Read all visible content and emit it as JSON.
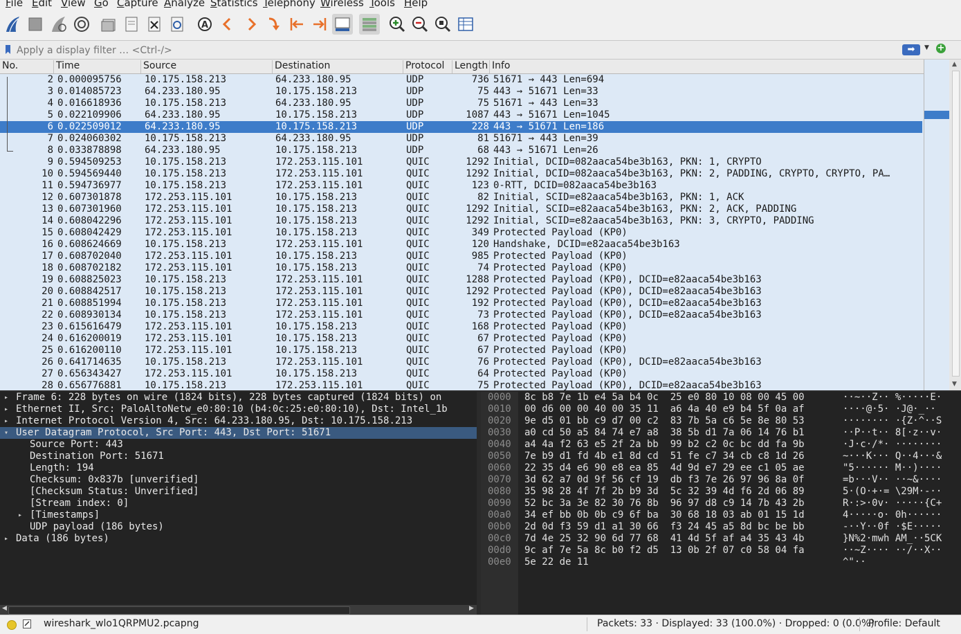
{
  "menubar": {
    "items": [
      "File",
      "Edit",
      "View",
      "Go",
      "Capture",
      "Analyze",
      "Statistics",
      "Telephony",
      "Wireless",
      "Tools",
      "Help"
    ]
  },
  "toolbar": {
    "icons": [
      "shark-fin-start-icon",
      "stop-capture-icon",
      "restart-capture-icon",
      "capture-options-icon",
      "open-file-icon",
      "save-file-icon",
      "close-file-icon",
      "reload-file-icon",
      "find-packet-icon",
      "go-back-icon",
      "go-forward-icon",
      "go-to-packet-icon",
      "first-packet-icon",
      "last-packet-icon",
      "autoscroll-icon",
      "colorize-icon",
      "zoom-in-icon",
      "zoom-out-icon",
      "zoom-normal-icon",
      "resize-columns-icon"
    ]
  },
  "filter": {
    "placeholder": "Apply a display filter … <Ctrl-/>",
    "apply_label": "➡"
  },
  "packet_list": {
    "columns": [
      "No.",
      "Time",
      "Source",
      "Destination",
      "Protocol",
      "Length",
      "Info"
    ],
    "rows": [
      {
        "no": "2",
        "time": "0.000095756",
        "src": "10.175.158.213",
        "dst": "64.233.180.95",
        "proto": "UDP",
        "len": "736",
        "info": "51671 → 443 Len=694"
      },
      {
        "no": "3",
        "time": "0.014085723",
        "src": "64.233.180.95",
        "dst": "10.175.158.213",
        "proto": "UDP",
        "len": "75",
        "info": "443 → 51671 Len=33"
      },
      {
        "no": "4",
        "time": "0.016618936",
        "src": "10.175.158.213",
        "dst": "64.233.180.95",
        "proto": "UDP",
        "len": "75",
        "info": "51671 → 443 Len=33"
      },
      {
        "no": "5",
        "time": "0.022109906",
        "src": "64.233.180.95",
        "dst": "10.175.158.213",
        "proto": "UDP",
        "len": "1087",
        "info": "443 → 51671 Len=1045"
      },
      {
        "no": "6",
        "time": "0.022509012",
        "src": "64.233.180.95",
        "dst": "10.175.158.213",
        "proto": "UDP",
        "len": "228",
        "info": "443 → 51671 Len=186"
      },
      {
        "no": "7",
        "time": "0.024060302",
        "src": "10.175.158.213",
        "dst": "64.233.180.95",
        "proto": "UDP",
        "len": "81",
        "info": "51671 → 443 Len=39"
      },
      {
        "no": "8",
        "time": "0.033878898",
        "src": "64.233.180.95",
        "dst": "10.175.158.213",
        "proto": "UDP",
        "len": "68",
        "info": "443 → 51671 Len=26"
      },
      {
        "no": "9",
        "time": "0.594509253",
        "src": "10.175.158.213",
        "dst": "172.253.115.101",
        "proto": "QUIC",
        "len": "1292",
        "info": "Initial, DCID=082aaca54be3b163, PKN: 1, CRYPTO"
      },
      {
        "no": "10",
        "time": "0.594569440",
        "src": "10.175.158.213",
        "dst": "172.253.115.101",
        "proto": "QUIC",
        "len": "1292",
        "info": "Initial, DCID=082aaca54be3b163, PKN: 2, PADDING, CRYPTO, CRYPTO, PA…"
      },
      {
        "no": "11",
        "time": "0.594736977",
        "src": "10.175.158.213",
        "dst": "172.253.115.101",
        "proto": "QUIC",
        "len": "123",
        "info": "0-RTT, DCID=082aaca54be3b163"
      },
      {
        "no": "12",
        "time": "0.607301878",
        "src": "172.253.115.101",
        "dst": "10.175.158.213",
        "proto": "QUIC",
        "len": "82",
        "info": "Initial, SCID=e82aaca54be3b163, PKN: 1, ACK"
      },
      {
        "no": "13",
        "time": "0.607301960",
        "src": "172.253.115.101",
        "dst": "10.175.158.213",
        "proto": "QUIC",
        "len": "1292",
        "info": "Initial, SCID=e82aaca54be3b163, PKN: 2, ACK, PADDING"
      },
      {
        "no": "14",
        "time": "0.608042296",
        "src": "172.253.115.101",
        "dst": "10.175.158.213",
        "proto": "QUIC",
        "len": "1292",
        "info": "Initial, SCID=e82aaca54be3b163, PKN: 3, CRYPTO, PADDING"
      },
      {
        "no": "15",
        "time": "0.608042429",
        "src": "172.253.115.101",
        "dst": "10.175.158.213",
        "proto": "QUIC",
        "len": "349",
        "info": "Protected Payload (KP0)"
      },
      {
        "no": "16",
        "time": "0.608624669",
        "src": "10.175.158.213",
        "dst": "172.253.115.101",
        "proto": "QUIC",
        "len": "120",
        "info": "Handshake, DCID=e82aaca54be3b163"
      },
      {
        "no": "17",
        "time": "0.608702040",
        "src": "172.253.115.101",
        "dst": "10.175.158.213",
        "proto": "QUIC",
        "len": "985",
        "info": "Protected Payload (KP0)"
      },
      {
        "no": "18",
        "time": "0.608702182",
        "src": "172.253.115.101",
        "dst": "10.175.158.213",
        "proto": "QUIC",
        "len": "74",
        "info": "Protected Payload (KP0)"
      },
      {
        "no": "19",
        "time": "0.608825023",
        "src": "10.175.158.213",
        "dst": "172.253.115.101",
        "proto": "QUIC",
        "len": "1288",
        "info": "Protected Payload (KP0), DCID=e82aaca54be3b163"
      },
      {
        "no": "20",
        "time": "0.608842517",
        "src": "10.175.158.213",
        "dst": "172.253.115.101",
        "proto": "QUIC",
        "len": "1292",
        "info": "Protected Payload (KP0), DCID=e82aaca54be3b163"
      },
      {
        "no": "21",
        "time": "0.608851994",
        "src": "10.175.158.213",
        "dst": "172.253.115.101",
        "proto": "QUIC",
        "len": "192",
        "info": "Protected Payload (KP0), DCID=e82aaca54be3b163"
      },
      {
        "no": "22",
        "time": "0.608930134",
        "src": "10.175.158.213",
        "dst": "172.253.115.101",
        "proto": "QUIC",
        "len": "73",
        "info": "Protected Payload (KP0), DCID=e82aaca54be3b163"
      },
      {
        "no": "23",
        "time": "0.615616479",
        "src": "172.253.115.101",
        "dst": "10.175.158.213",
        "proto": "QUIC",
        "len": "168",
        "info": "Protected Payload (KP0)"
      },
      {
        "no": "24",
        "time": "0.616200019",
        "src": "172.253.115.101",
        "dst": "10.175.158.213",
        "proto": "QUIC",
        "len": "67",
        "info": "Protected Payload (KP0)"
      },
      {
        "no": "25",
        "time": "0.616200110",
        "src": "172.253.115.101",
        "dst": "10.175.158.213",
        "proto": "QUIC",
        "len": "67",
        "info": "Protected Payload (KP0)"
      },
      {
        "no": "26",
        "time": "0.641714635",
        "src": "10.175.158.213",
        "dst": "172.253.115.101",
        "proto": "QUIC",
        "len": "76",
        "info": "Protected Payload (KP0), DCID=e82aaca54be3b163"
      },
      {
        "no": "27",
        "time": "0.656343427",
        "src": "172.253.115.101",
        "dst": "10.175.158.213",
        "proto": "QUIC",
        "len": "64",
        "info": "Protected Payload (KP0)"
      },
      {
        "no": "28",
        "time": "0.656776881",
        "src": "10.175.158.213",
        "dst": "172.253.115.101",
        "proto": "QUIC",
        "len": "75",
        "info": "Protected Payload (KP0), DCID=e82aaca54be3b163"
      }
    ],
    "selected_no": "6"
  },
  "details": {
    "rows": [
      {
        "exp": "▸",
        "indent": 0,
        "text": "Frame 6: 228 bytes on wire (1824 bits), 228 bytes captured (1824 bits) on"
      },
      {
        "exp": "▸",
        "indent": 0,
        "text": "Ethernet II, Src: PaloAltoNetw_e0:80:10 (b4:0c:25:e0:80:10), Dst: Intel_1b"
      },
      {
        "exp": "▸",
        "indent": 0,
        "text": "Internet Protocol Version 4, Src: 64.233.180.95, Dst: 10.175.158.213"
      },
      {
        "exp": "▾",
        "indent": 0,
        "text": "User Datagram Protocol, Src Port: 443, Dst Port: 51671",
        "selected": true
      },
      {
        "exp": "",
        "indent": 1,
        "text": "Source Port: 443"
      },
      {
        "exp": "",
        "indent": 1,
        "text": "Destination Port: 51671"
      },
      {
        "exp": "",
        "indent": 1,
        "text": "Length: 194"
      },
      {
        "exp": "",
        "indent": 1,
        "text": "Checksum: 0x837b [unverified]"
      },
      {
        "exp": "",
        "indent": 1,
        "text": "[Checksum Status: Unverified]"
      },
      {
        "exp": "",
        "indent": 1,
        "text": "[Stream index: 0]"
      },
      {
        "exp": "▸",
        "indent": 1,
        "text": "[Timestamps]"
      },
      {
        "exp": "",
        "indent": 1,
        "text": "UDP payload (186 bytes)"
      },
      {
        "exp": "▸",
        "indent": 0,
        "text": "Data (186 bytes)"
      }
    ]
  },
  "bytes": {
    "offsets": [
      "0000",
      "0010",
      "0020",
      "0030",
      "0040",
      "0050",
      "0060",
      "0070",
      "0080",
      "0090",
      "00a0",
      "00b0",
      "00c0",
      "00d0",
      "00e0"
    ],
    "hex": [
      "8c b8 7e 1b e4 5a b4 0c  25 e0 80 10 08 00 45 00",
      "00 d6 00 00 40 00 35 11  a6 4a 40 e9 b4 5f 0a af",
      "9e d5 01 bb c9 d7 00 c2  83 7b 5a c6 5e 8e 80 53",
      "a0 cd 50 a5 84 74 e7 a8  38 5b d1 7a 06 14 76 b1",
      "a4 4a f2 63 e5 2f 2a bb  99 b2 c2 0c bc dd fa 9b",
      "7e b9 d1 fd 4b e1 8d cd  51 fe c7 34 cb c8 1d 26",
      "22 35 d4 e6 90 e8 ea 85  4d 9d e7 29 ee c1 05 ae",
      "3d 62 a7 0d 9f 56 cf 19  db f3 7e 26 97 96 8a 0f",
      "35 98 28 4f 7f 2b b9 3d  5c 32 39 4d f6 2d 06 89",
      "52 bc 3a 3e 82 30 76 8b  96 97 d8 c9 14 7b 43 2b",
      "34 ef bb 0b 0b c9 6f ba  30 68 18 03 ab 01 15 1d",
      "2d 0d f3 59 d1 a1 30 66  f3 24 45 a5 8d bc be bb",
      "7d 4e 25 32 90 6d 77 68  41 4d 5f af a4 35 43 4b",
      "9c af 7e 5a 8c b0 f2 d5  13 0b 2f 07 c0 58 04 fa",
      "5e 22 de 11"
    ],
    "ascii": [
      "··~··Z·· %·····E·",
      "····@·5· ·J@·_··",
      "········ ·{Z·^··S",
      "··P··t·· 8[·z··v·",
      "·J·c·/*· ········",
      "~···K··· Q··4···&",
      "\"5······ M··)····",
      "=b···V·· ··~&····",
      "5·(O·+·= \\29M·-··",
      "R·:>·0v· ·····{C+",
      "4·····o· 0h······",
      "-··Y··0f ·$E·····",
      "}N%2·mwh AM_··5CK",
      "··~Z···· ··/··X··",
      "^\"··"
    ]
  },
  "statusbar": {
    "file": "wireshark_wlo1QRPMU2.pcapng",
    "packets": "Packets: 33 · Displayed: 33 (100.0%) · Dropped: 0 (0.0%)",
    "profile": "Profile: Default"
  }
}
